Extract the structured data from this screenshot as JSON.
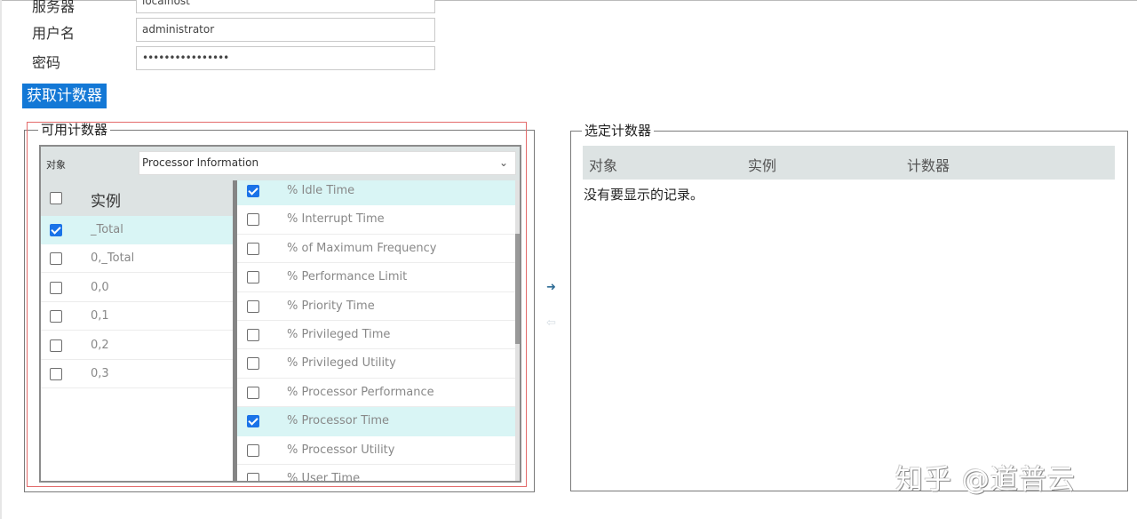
{
  "form": {
    "server_label": "服务器",
    "server_value": "localhost",
    "username_label": "用户名",
    "username_value": "administrator",
    "password_label": "密码",
    "password_value": "••••••••••••••••"
  },
  "fetch_button": {
    "label": "获取计数器",
    "color": "#1378d6"
  },
  "available": {
    "legend": "可用计数器",
    "object_label": "对象",
    "object_value": "Processor Information",
    "instance_header": "实例",
    "instances": [
      {
        "label": "_Total",
        "checked": true
      },
      {
        "label": "0,_Total",
        "checked": false
      },
      {
        "label": "0,0",
        "checked": false
      },
      {
        "label": "0,1",
        "checked": false
      },
      {
        "label": "0,2",
        "checked": false
      },
      {
        "label": "0,3",
        "checked": false
      }
    ],
    "counters": [
      {
        "label": "% Idle Time",
        "checked": true
      },
      {
        "label": "% Interrupt Time",
        "checked": false
      },
      {
        "label": "% of Maximum Frequency",
        "checked": false
      },
      {
        "label": "% Performance Limit",
        "checked": false
      },
      {
        "label": "% Priority Time",
        "checked": false
      },
      {
        "label": "% Privileged Time",
        "checked": false
      },
      {
        "label": "% Privileged Utility",
        "checked": false
      },
      {
        "label": "% Processor Performance",
        "checked": false
      },
      {
        "label": "% Processor Time",
        "checked": true
      },
      {
        "label": "% Processor Utility",
        "checked": false
      },
      {
        "label": "% User Time",
        "checked": false
      }
    ]
  },
  "transfer": {
    "add_icon": "arrow-right-icon",
    "remove_icon": "arrow-left-icon"
  },
  "selected": {
    "legend": "选定计数器",
    "columns": [
      "对象",
      "实例",
      "计数器"
    ],
    "empty_message": "没有要显示的记录。"
  },
  "watermark": "知乎 @道普云"
}
